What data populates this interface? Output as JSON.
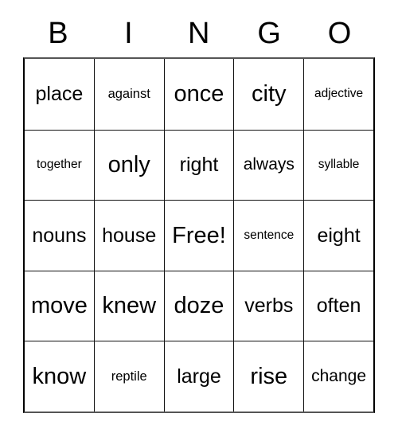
{
  "card": {
    "header_letters": [
      "B",
      "I",
      "N",
      "G",
      "O"
    ],
    "rows": [
      [
        "place",
        "against",
        "once",
        "city",
        "adjective"
      ],
      [
        "together",
        "only",
        "right",
        "always",
        "syllable"
      ],
      [
        "nouns",
        "house",
        "Free!",
        "sentence",
        "eight"
      ],
      [
        "move",
        "knew",
        "doze",
        "verbs",
        "often"
      ],
      [
        "know",
        "reptile",
        "large",
        "rise",
        "change"
      ]
    ],
    "free_space": {
      "row": 2,
      "column": 2,
      "label": "Free!"
    },
    "colors": {
      "text": "#000000",
      "grid_line": "#111111",
      "outer_edge": "#555555",
      "background": "#ffffff"
    }
  }
}
